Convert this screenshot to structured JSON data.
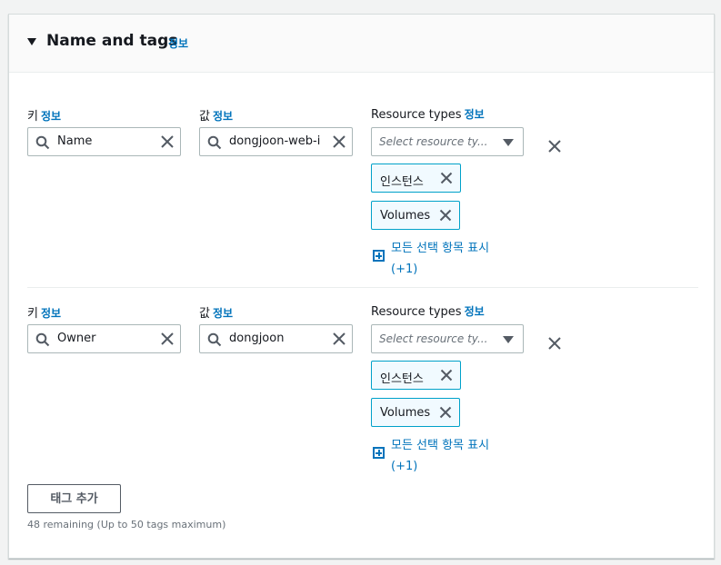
{
  "section": {
    "title": "Name and tags",
    "info": "정보"
  },
  "tags": [
    {
      "key_label": "키",
      "key_info": "정보",
      "key_value": "Name",
      "value_label": "값",
      "value_info": "정보",
      "value_value": "dongjoon-web-i",
      "rt_label": "Resource types",
      "rt_info": "정보",
      "rt_placeholder": "Select resource ty...",
      "tokens": [
        "인스턴스",
        "Volumes"
      ],
      "show_all_line1": "모든 선택 항목 표시",
      "show_all_line2": "(+1)"
    },
    {
      "key_label": "키",
      "key_info": "정보",
      "key_value": "Owner",
      "value_label": "값",
      "value_info": "정보",
      "value_value": "dongjoon",
      "rt_label": "Resource types",
      "rt_info": "정보",
      "rt_placeholder": "Select resource ty...",
      "tokens": [
        "인스턴스",
        "Volumes"
      ],
      "show_all_line1": "모든 선택 항목 표시",
      "show_all_line2": "(+1)"
    }
  ],
  "add_tag_label": "태그 추가",
  "remaining_text": "48 remaining (Up to 50 tags maximum)",
  "colors": {
    "link": "#0073bb",
    "token_border": "#00a1c9",
    "token_bg": "#f1faff"
  },
  "icons": {
    "search": "search-icon",
    "clear": "close-icon",
    "dropdown": "caret-down-icon",
    "expand": "plus-square-icon"
  }
}
